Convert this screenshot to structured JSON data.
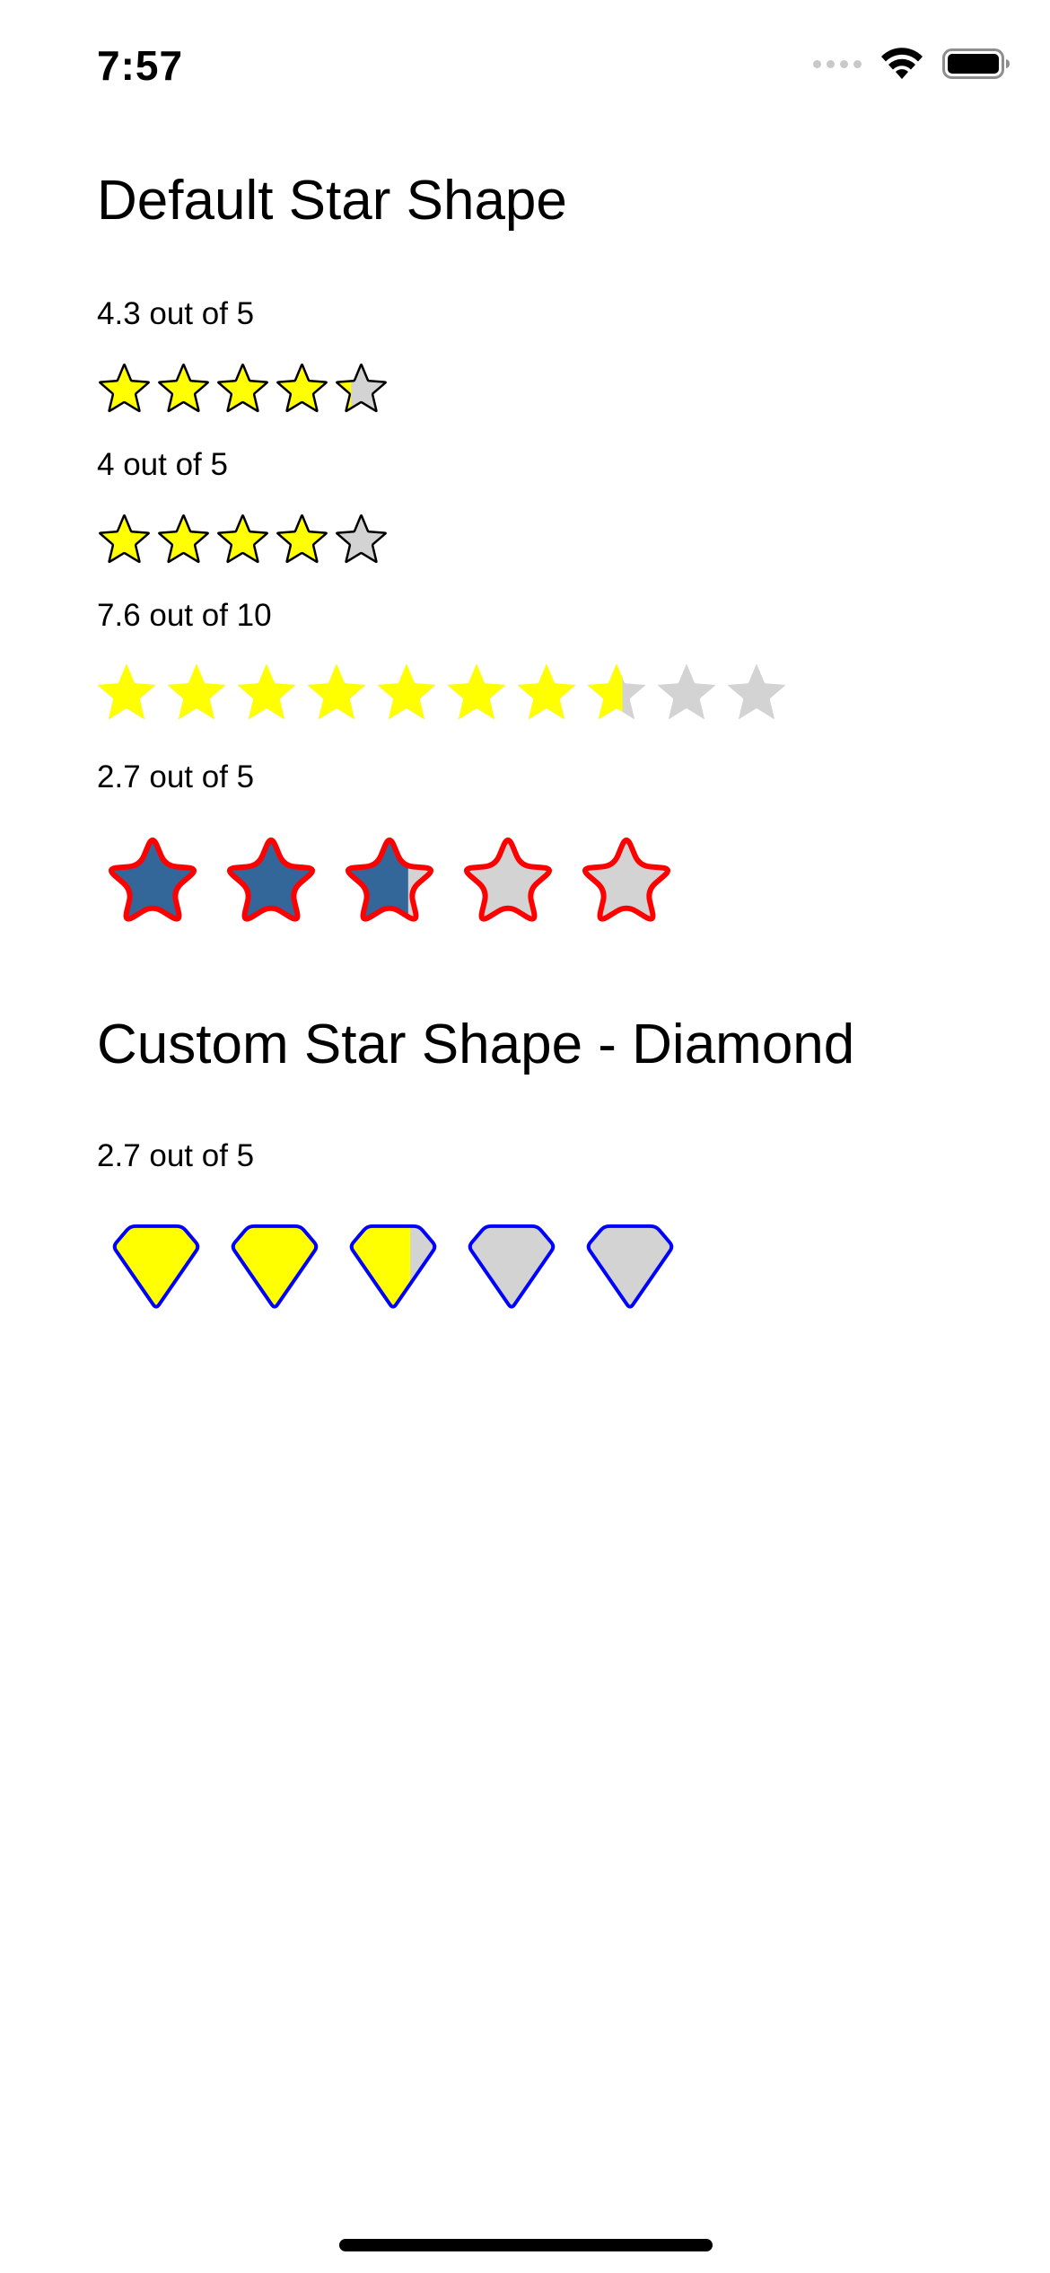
{
  "status_bar": {
    "time": "7:57",
    "icons": [
      "cellular-signal-icon",
      "wifi-icon",
      "battery-icon"
    ]
  },
  "sections": [
    {
      "title": "Default Star Shape",
      "ratings": [
        {
          "label": "4.3 out of 5",
          "value": 4.3,
          "max": 5,
          "shape": "star",
          "fill_color": "#FFFF00",
          "empty_color": "#D3D3D3",
          "stroke_color": "#000000"
        },
        {
          "label": "4 out of 5",
          "value": 4,
          "max": 5,
          "shape": "star",
          "fill_color": "#FFFF00",
          "empty_color": "#D3D3D3",
          "stroke_color": "#000000"
        },
        {
          "label": "7.6 out of 10",
          "value": 7.6,
          "max": 10,
          "shape": "star",
          "fill_color": "#FFFF00",
          "empty_color": "#D3D3D3",
          "stroke_color": ""
        },
        {
          "label": "2.7 out of 5",
          "value": 2.7,
          "max": 5,
          "shape": "rounded-star",
          "fill_color": "#336699",
          "empty_color": "#D3D3D3",
          "stroke_color": "#FF0000"
        }
      ]
    },
    {
      "title": "Custom Star Shape - Diamond",
      "ratings": [
        {
          "label": "2.7 out of 5",
          "value": 2.7,
          "max": 5,
          "shape": "diamond",
          "fill_color": "#FFFF00",
          "empty_color": "#D3D3D3",
          "stroke_color": "#0000FF"
        }
      ]
    }
  ]
}
